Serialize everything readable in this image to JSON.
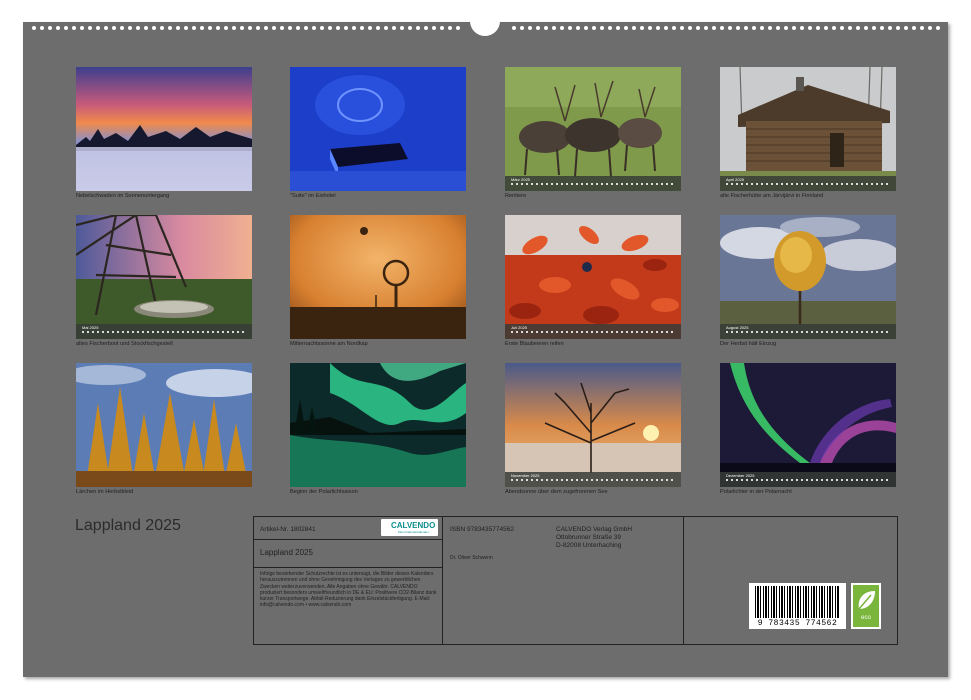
{
  "calendar_title": "Lappland 2025",
  "colors": {
    "sheet": "#6d6d6d",
    "logo_teal": "#0e8e8e",
    "eco_green": "#7ab53c"
  },
  "photos": [
    {
      "caption": "Nebelschwaden im Sonnenuntergang",
      "month": ""
    },
    {
      "caption": "\"Suite\" im Eishotel",
      "month": ""
    },
    {
      "caption": "Rentiere",
      "month": "März 2025"
    },
    {
      "caption": "alte Fischerhütte am Järvijärvi in Finnland",
      "month": "April 2025"
    },
    {
      "caption": "altes Fischerboot und Stockfischgestell",
      "month": "Mai 2025"
    },
    {
      "caption": "Mitternachtssonne am Nordkap",
      "month": ""
    },
    {
      "caption": "Erste Blaubeeren reifen",
      "month": "Juli 2025"
    },
    {
      "caption": "Der Herbst hält Einzug",
      "month": "August 2025"
    },
    {
      "caption": "Lärchen im Herbstkleid",
      "month": ""
    },
    {
      "caption": "Beginn der Polarlichtsaison",
      "month": ""
    },
    {
      "caption": "Abendsonne über dem zugefrorenen See",
      "month": "November 2025"
    },
    {
      "caption": "Polarlichter in der Polarnacht",
      "month": "Dezember 2025"
    }
  ],
  "info": {
    "article": "Artikel-Nr. 1802841",
    "title": "Lappland 2025",
    "isbn": "ISBN 9783435774562",
    "publisher_lines": [
      "CALVENDO Verlag GmbH",
      "Ottobrunner Straße 39",
      "D-82008 Unterhaching"
    ],
    "author": "Dr. Oliver Schwenn",
    "logo_word": "CALVENDO",
    "logo_sub": "Mein Kalenderkalender",
    "legal_text": "Infolge bestehender Schutzrechte ist es untersagt, die Bilder dieses Kalenders herauszutrennen und ohne Genehmigung des Verlages zu gewerblichen Zwecken weiterzuverwenden. Alle Angaben ohne Gewähr. CALVENDO produziert besonders umweltfreundlich in DE & EU: Positivere CO2-Bilanz dank kurzer Transportwege. Abfall-Reduzierung dank Einzelstückfertigung. E-Mail: info@calvendo.com • www.calvendo.com",
    "barcode_number": "9 783435 774562",
    "eco_label": "eco"
  }
}
